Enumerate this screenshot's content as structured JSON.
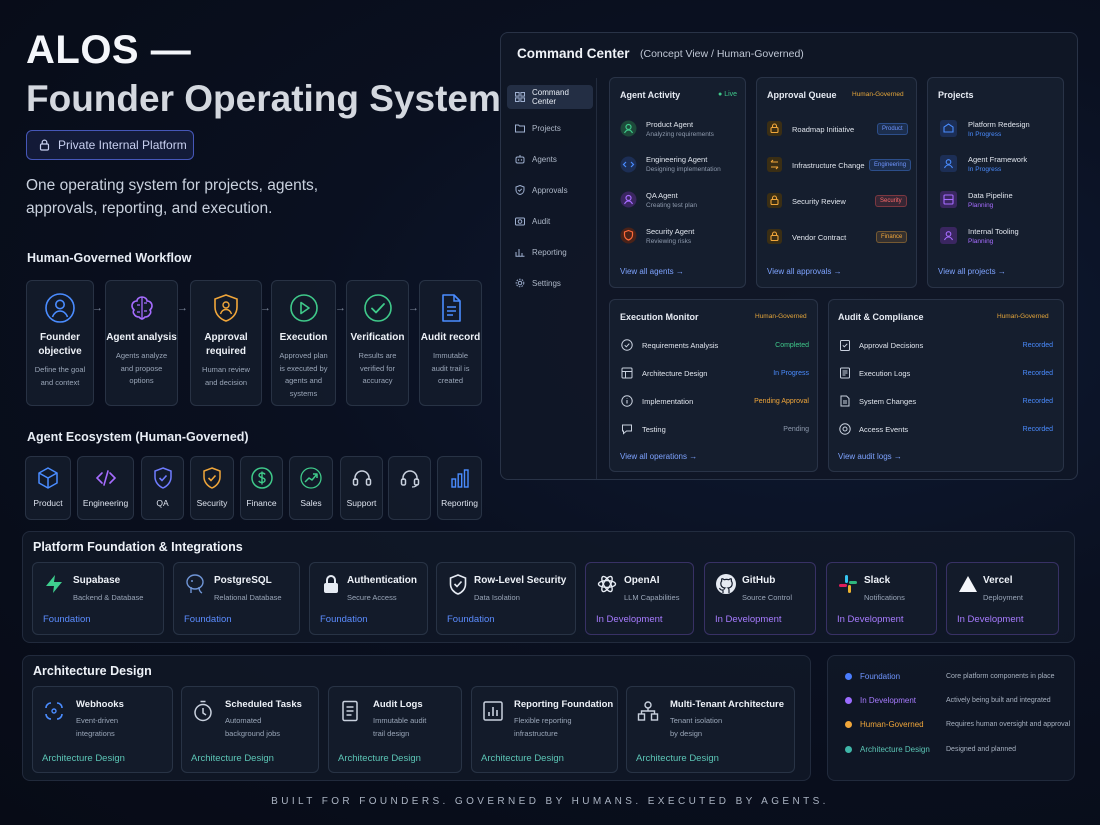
{
  "hero": {
    "title": "ALOS —",
    "subtitle": "Founder Operating System",
    "badge": "Private Internal Platform",
    "tagline": "One operating system for projects, agents, approvals, reporting, and execution."
  },
  "workflow": {
    "title": "Human-Governed Workflow",
    "steps": [
      {
        "title": "Founder objective",
        "desc": "Define the goal and context",
        "icon": "user-icon",
        "color": "#4a8cff"
      },
      {
        "title": "Agent analysis",
        "desc": "Agents analyze and propose options",
        "icon": "brain-icon",
        "color": "#a66cff"
      },
      {
        "title": "Approval required",
        "desc": "Human review and decision",
        "icon": "shield-icon",
        "color": "#f0a63a"
      },
      {
        "title": "Execution",
        "desc": "Approved plan is executed by agents and systems",
        "icon": "play-icon",
        "color": "#3fc98a"
      },
      {
        "title": "Verification",
        "desc": "Results are verified for accuracy",
        "icon": "check-circle-icon",
        "color": "#3fc98a"
      },
      {
        "title": "Audit record",
        "desc": "Immutable audit trail is created",
        "icon": "document-icon",
        "color": "#4a8cff"
      }
    ]
  },
  "ecosystem": {
    "title": "Agent Ecosystem (Human-Governed)",
    "items": [
      {
        "label": "Product",
        "icon": "cube-icon",
        "color": "#4a8cff"
      },
      {
        "label": "Engineering",
        "icon": "code-icon",
        "color": "#a66cff"
      },
      {
        "label": "QA",
        "icon": "shield-check-icon",
        "color": "#6f7cff"
      },
      {
        "label": "Security",
        "icon": "shield-check-icon",
        "color": "#f0a63a"
      },
      {
        "label": "Finance",
        "icon": "dollar-icon",
        "color": "#3fc98a"
      },
      {
        "label": "Sales",
        "icon": "trend-icon",
        "color": "#3fc98a"
      },
      {
        "label": "Support",
        "icon": "headset-icon",
        "color": "#c9d1de"
      },
      {
        "label": "",
        "icon": "headset-icon",
        "color": "#c9d1de"
      },
      {
        "label": "Reporting",
        "icon": "bar-chart-icon",
        "color": "#4a8cff"
      }
    ]
  },
  "command_center": {
    "title": "Command Center",
    "subtitle": "(Concept View / Human-Governed)",
    "nav": [
      {
        "label": "Command Center",
        "icon": "grid-icon"
      },
      {
        "label": "Projects",
        "icon": "folder-icon"
      },
      {
        "label": "Agents",
        "icon": "robot-icon"
      },
      {
        "label": "Approvals",
        "icon": "shield-icon"
      },
      {
        "label": "Audit",
        "icon": "camera-icon"
      },
      {
        "label": "Reporting",
        "icon": "bar-chart-icon"
      },
      {
        "label": "Settings",
        "icon": "gear-icon"
      }
    ],
    "agent_activity": {
      "title": "Agent Activity",
      "live": "Live",
      "rows": [
        {
          "title": "Product Agent",
          "sub": "Analyzing requirements",
          "color": "#3fc98a"
        },
        {
          "title": "Engineering Agent",
          "sub": "Designing implementation",
          "color": "#4a8cff"
        },
        {
          "title": "QA Agent",
          "sub": "Creating test plan",
          "color": "#a66cff"
        },
        {
          "title": "Security Agent",
          "sub": "Reviewing risks",
          "color": "#ff6a3a"
        }
      ],
      "link": "View all agents"
    },
    "approval_queue": {
      "title": "Approval Queue",
      "tag": "Human-Governed",
      "rows": [
        {
          "title": "Roadmap Initiative",
          "chip": "Product",
          "chip_color": "#4a8cff"
        },
        {
          "title": "Infrastructure Change",
          "chip": "Engineering",
          "chip_color": "#4a8cff"
        },
        {
          "title": "Security Review",
          "chip": "Security",
          "chip_color": "#ff5a5a"
        },
        {
          "title": "Vendor Contract",
          "chip": "Finance",
          "chip_color": "#f0a63a"
        }
      ],
      "link": "View all approvals"
    },
    "projects": {
      "title": "Projects",
      "rows": [
        {
          "title": "Platform Redesign",
          "status": "In Progress",
          "color": "#4a8cff"
        },
        {
          "title": "Agent Framework",
          "status": "In Progress",
          "color": "#4a8cff"
        },
        {
          "title": "Data Pipeline",
          "status": "Planning",
          "color": "#a66cff"
        },
        {
          "title": "Internal Tooling",
          "status": "Planning",
          "color": "#a66cff"
        }
      ],
      "link": "View all projects"
    },
    "execution_monitor": {
      "title": "Execution Monitor",
      "tag": "Human-Governed",
      "rows": [
        {
          "title": "Requirements Analysis",
          "status": "Completed",
          "color": "#3fc98a"
        },
        {
          "title": "Architecture Design",
          "status": "In Progress",
          "color": "#4a8cff"
        },
        {
          "title": "Implementation",
          "status": "Pending Approval",
          "color": "#f0a63a"
        },
        {
          "title": "Testing",
          "status": "Pending",
          "color": "#8e9aad"
        }
      ],
      "link": "View all operations"
    },
    "audit": {
      "title": "Audit & Compliance",
      "tag": "Human-Governed",
      "rows": [
        {
          "title": "Approval Decisions",
          "status": "Recorded"
        },
        {
          "title": "Execution Logs",
          "status": "Recorded"
        },
        {
          "title": "System Changes",
          "status": "Recorded"
        },
        {
          "title": "Access Events",
          "status": "Recorded"
        }
      ],
      "link": "View audit logs"
    }
  },
  "foundation": {
    "title": "Platform Foundation & Integrations",
    "items": [
      {
        "name": "Supabase",
        "sub": "Backend & Database",
        "status": "Foundation",
        "icon": "supabase-icon"
      },
      {
        "name": "PostgreSQL",
        "sub": "Relational Database",
        "status": "Foundation",
        "icon": "postgres-icon"
      },
      {
        "name": "Authentication",
        "sub": "Secure Access",
        "status": "Foundation",
        "icon": "lock-icon"
      },
      {
        "name": "Row-Level Security",
        "sub": "Data Isolation",
        "status": "Foundation",
        "icon": "shield-check-icon"
      },
      {
        "name": "OpenAI",
        "sub": "LLM Capabilities",
        "status": "In Development",
        "icon": "openai-icon"
      },
      {
        "name": "GitHub",
        "sub": "Source Control",
        "status": "In Development",
        "icon": "github-icon"
      },
      {
        "name": "Slack",
        "sub": "Notifications",
        "status": "In Development",
        "icon": "slack-icon"
      },
      {
        "name": "Vercel",
        "sub": "Deployment",
        "status": "In Development",
        "icon": "vercel-icon"
      }
    ]
  },
  "architecture": {
    "title": "Architecture Design",
    "items": [
      {
        "name": "Webhooks",
        "desc1": "Event-driven",
        "desc2": "integrations",
        "status": "Architecture Design",
        "icon": "webhook-icon"
      },
      {
        "name": "Scheduled Tasks",
        "desc1": "Automated",
        "desc2": "background jobs",
        "status": "Architecture Design",
        "icon": "timer-icon"
      },
      {
        "name": "Audit Logs",
        "desc1": "Immutable audit",
        "desc2": "trail design",
        "status": "Architecture Design",
        "icon": "log-icon"
      },
      {
        "name": "Reporting Foundation",
        "desc1": "Flexible reporting",
        "desc2": "infrastructure",
        "status": "Architecture Design",
        "icon": "report-icon"
      },
      {
        "name": "Multi-Tenant Architecture",
        "desc1": "Tenant isolation",
        "desc2": "by design",
        "status": "Architecture Design",
        "icon": "tenant-icon"
      }
    ]
  },
  "legend": [
    {
      "name": "Foundation",
      "desc": "Core platform components in place",
      "color": "#4a7dff"
    },
    {
      "name": "In Development",
      "desc": "Actively being built and integrated",
      "color": "#9b6cff"
    },
    {
      "name": "Human-Governed",
      "desc": "Requires human oversight and approval",
      "color": "#f0a63a"
    },
    {
      "name": "Architecture Design",
      "desc": "Designed and planned",
      "color": "#3fb6a8"
    }
  ],
  "footer": "BUILT FOR FOUNDERS. GOVERNED BY HUMANS. EXECUTED BY AGENTS."
}
